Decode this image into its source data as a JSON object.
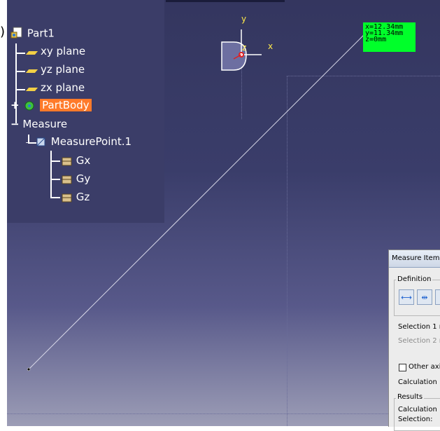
{
  "tree": {
    "root": "Part1",
    "planes": [
      "xy plane",
      "yz plane",
      "zx plane"
    ],
    "body": "PartBody",
    "measure": "Measure",
    "measure_point": "MeasurePoint.1",
    "params": [
      "Gx",
      "Gy",
      "Gz"
    ]
  },
  "edge_glyph": ")",
  "axis": {
    "x": "x",
    "y": "y",
    "z": "z"
  },
  "coords": {
    "x": "x=12.34mm",
    "y": "y=11.34mm",
    "z": "z=0mm"
  },
  "dialog": {
    "title": "Measure Item",
    "definition": "Definition",
    "selection1": "Selection 1 r",
    "selection2": "Selection 2 r",
    "other_axis": "Other axi",
    "calculation": "Calculation",
    "results": "Results",
    "calculation2": "Calculation",
    "selection": "Selection:"
  },
  "colors": {
    "background_top": "#34365f",
    "highlight": "#ff7a2a",
    "coord_box": "#00ff2a",
    "plane_icon": "#f2cf45"
  }
}
